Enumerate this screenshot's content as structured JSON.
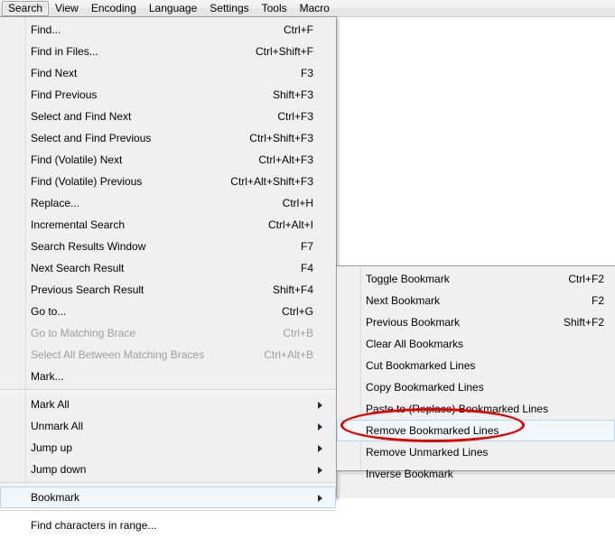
{
  "menubar": {
    "items": [
      {
        "label": "Search",
        "active": true
      },
      {
        "label": "View",
        "active": false
      },
      {
        "label": "Encoding",
        "active": false
      },
      {
        "label": "Language",
        "active": false
      },
      {
        "label": "Settings",
        "active": false
      },
      {
        "label": "Tools",
        "active": false
      },
      {
        "label": "Macro",
        "active": false
      }
    ]
  },
  "search_menu": {
    "items": [
      {
        "label": "Find...",
        "shortcut": "Ctrl+F"
      },
      {
        "label": "Find in Files...",
        "shortcut": "Ctrl+Shift+F"
      },
      {
        "label": "Find Next",
        "shortcut": "F3"
      },
      {
        "label": "Find Previous",
        "shortcut": "Shift+F3"
      },
      {
        "label": "Select and Find Next",
        "shortcut": "Ctrl+F3"
      },
      {
        "label": "Select and Find Previous",
        "shortcut": "Ctrl+Shift+F3"
      },
      {
        "label": "Find (Volatile) Next",
        "shortcut": "Ctrl+Alt+F3"
      },
      {
        "label": "Find (Volatile) Previous",
        "shortcut": "Ctrl+Alt+Shift+F3"
      },
      {
        "label": "Replace...",
        "shortcut": "Ctrl+H"
      },
      {
        "label": "Incremental Search",
        "shortcut": "Ctrl+Alt+I"
      },
      {
        "label": "Search Results Window",
        "shortcut": "F7"
      },
      {
        "label": "Next Search Result",
        "shortcut": "F4"
      },
      {
        "label": "Previous Search Result",
        "shortcut": "Shift+F4"
      },
      {
        "label": "Go to...",
        "shortcut": "Ctrl+G"
      },
      {
        "label": "Go to Matching Brace",
        "shortcut": "Ctrl+B"
      },
      {
        "label": "Select All Between Matching Braces",
        "shortcut": "Ctrl+Alt+B"
      },
      {
        "label": "Mark...",
        "shortcut": ""
      },
      {
        "label": "Mark All",
        "shortcut": ""
      },
      {
        "label": "Unmark All",
        "shortcut": ""
      },
      {
        "label": "Jump up",
        "shortcut": ""
      },
      {
        "label": "Jump down",
        "shortcut": ""
      },
      {
        "label": "Bookmark",
        "shortcut": ""
      },
      {
        "label": "Find characters in range...",
        "shortcut": ""
      }
    ]
  },
  "bookmark_submenu": {
    "items": [
      {
        "label": "Toggle Bookmark",
        "shortcut": "Ctrl+F2"
      },
      {
        "label": "Next Bookmark",
        "shortcut": "F2"
      },
      {
        "label": "Previous Bookmark",
        "shortcut": "Shift+F2"
      },
      {
        "label": "Clear All Bookmarks",
        "shortcut": ""
      },
      {
        "label": "Cut Bookmarked Lines",
        "shortcut": ""
      },
      {
        "label": "Copy Bookmarked Lines",
        "shortcut": ""
      },
      {
        "label": "Paste to (Replace) Bookmarked Lines",
        "shortcut": ""
      },
      {
        "label": "Remove Bookmarked Lines",
        "shortcut": ""
      },
      {
        "label": "Remove Unmarked Lines",
        "shortcut": ""
      },
      {
        "label": "Inverse Bookmark",
        "shortcut": ""
      }
    ]
  },
  "annotation": {
    "target_label": "Remove Bookmarked Lines",
    "color": "#e60000",
    "shape": "oval"
  }
}
